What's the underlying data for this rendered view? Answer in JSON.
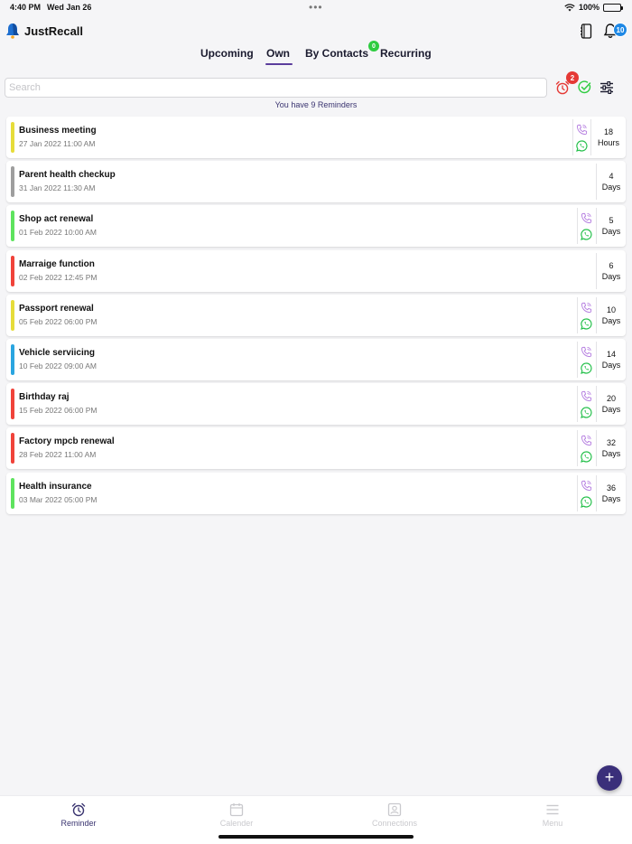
{
  "status_bar": {
    "time": "4:40 PM",
    "date": "Wed Jan 26",
    "dots": "•••",
    "battery": "100%"
  },
  "header": {
    "title": "JustRecall",
    "notification_count": "10"
  },
  "tabs": {
    "upcoming": "Upcoming",
    "own": "Own",
    "by_contacts": "By Contacts",
    "by_contacts_badge": "0",
    "recurring": "Recurring",
    "active": "Own"
  },
  "search": {
    "placeholder": "Search",
    "value": ""
  },
  "toolbar": {
    "alarm_badge": "2"
  },
  "reminder_count_text": "You have 9 Reminders",
  "reminders": [
    {
      "title": "Business meeting",
      "datetime": "27 Jan 2022 11:00 AM",
      "count": "18",
      "unit": "Hours",
      "color": "#e6dc3a",
      "contact": true
    },
    {
      "title": "Parent health checkup",
      "datetime": "31 Jan 2022 11:30 AM",
      "count": "4",
      "unit": "Days",
      "color": "#9e9e9e",
      "contact": false
    },
    {
      "title": "Shop act renewal",
      "datetime": "01 Feb 2022 10:00 AM",
      "count": "5",
      "unit": "Days",
      "color": "#5ee35e",
      "contact": true
    },
    {
      "title": "Marraige function",
      "datetime": "02 Feb 2022 12:45 PM",
      "count": "6",
      "unit": "Days",
      "color": "#f0433a",
      "contact": false
    },
    {
      "title": "Passport renewal",
      "datetime": "05 Feb 2022 06:00 PM",
      "count": "10",
      "unit": "Days",
      "color": "#e6dc3a",
      "contact": true
    },
    {
      "title": "Vehicle serviicing",
      "datetime": "10 Feb 2022 09:00 AM",
      "count": "14",
      "unit": "Days",
      "color": "#2aa5e0",
      "contact": true
    },
    {
      "title": "Birthday raj",
      "datetime": "15 Feb 2022 06:00 PM",
      "count": "20",
      "unit": "Days",
      "color": "#f0433a",
      "contact": true
    },
    {
      "title": "Factory mpcb renewal",
      "datetime": "28 Feb 2022 11:00 AM",
      "count": "32",
      "unit": "Days",
      "color": "#f0433a",
      "contact": true
    },
    {
      "title": "Health insurance",
      "datetime": "03 Mar 2022 05:00 PM",
      "count": "36",
      "unit": "Days",
      "color": "#5ee35e",
      "contact": true
    }
  ],
  "fab": {
    "label": "+"
  },
  "bottom_nav": {
    "reminder": "Reminder",
    "calendar": "Calender",
    "connections": "Connections",
    "menu": "Menu",
    "active": "Reminder"
  },
  "colors": {
    "accent": "#3a2f7a",
    "tab_underline": "#5b3d9c",
    "badge_blue": "#1e88e5",
    "badge_red": "#e53935",
    "badge_green": "#2ecc40"
  }
}
